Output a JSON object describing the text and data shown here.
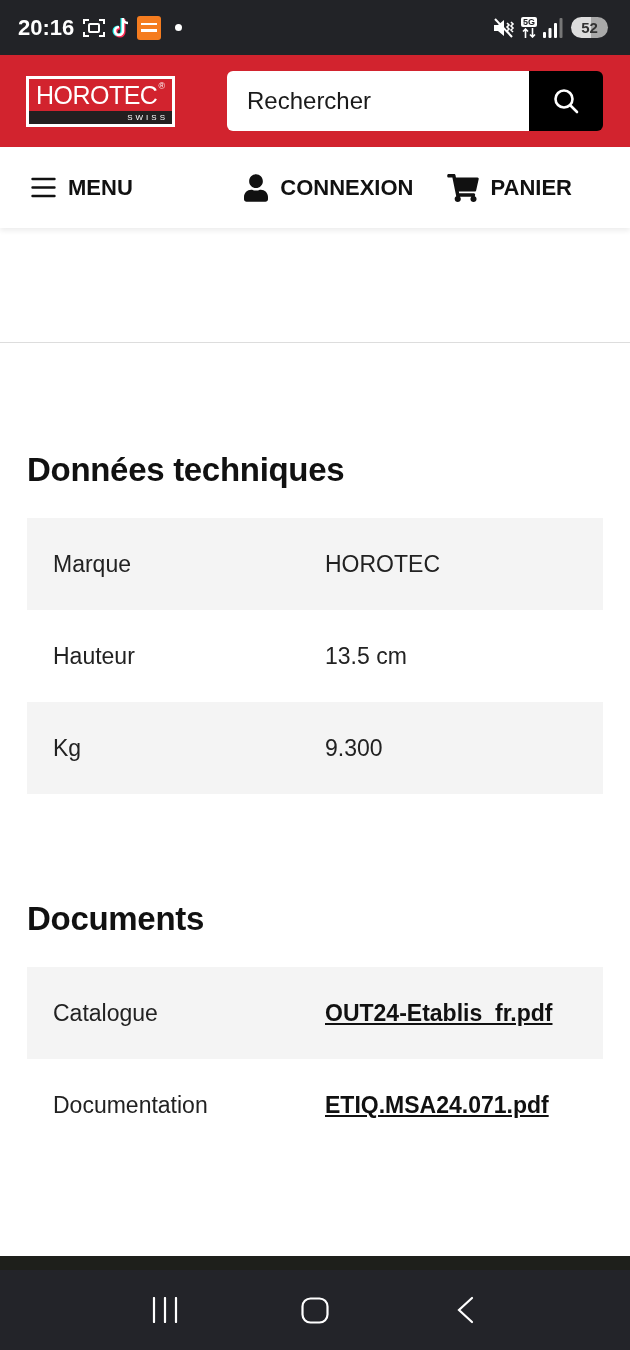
{
  "status_bar": {
    "time": "20:16",
    "network": "5G",
    "battery": "52"
  },
  "header": {
    "logo": {
      "name": "HOROTEC",
      "mark": "®",
      "tagline": "SWISS"
    },
    "search": {
      "placeholder": "Rechercher"
    }
  },
  "nav": [
    {
      "kind": "menu",
      "label": "MENU"
    },
    {
      "kind": "account",
      "label": "CONNEXION"
    },
    {
      "kind": "cart",
      "label": "PANIER"
    }
  ],
  "sections": [
    {
      "title": "Données techniques",
      "rows": [
        {
          "kind": "text",
          "label": "Marque",
          "value": "HOROTEC"
        },
        {
          "kind": "text",
          "label": "Hauteur",
          "value": "13.5 cm"
        },
        {
          "kind": "text",
          "label": "Kg",
          "value": "9.300"
        }
      ]
    },
    {
      "title": "Documents",
      "rows": [
        {
          "kind": "link",
          "label": "Catalogue",
          "value": "OUT24-Etablis_fr.pdf"
        },
        {
          "kind": "link",
          "label": "Documentation",
          "value": "ETIQ.MSA24.071.pdf"
        }
      ]
    }
  ]
}
